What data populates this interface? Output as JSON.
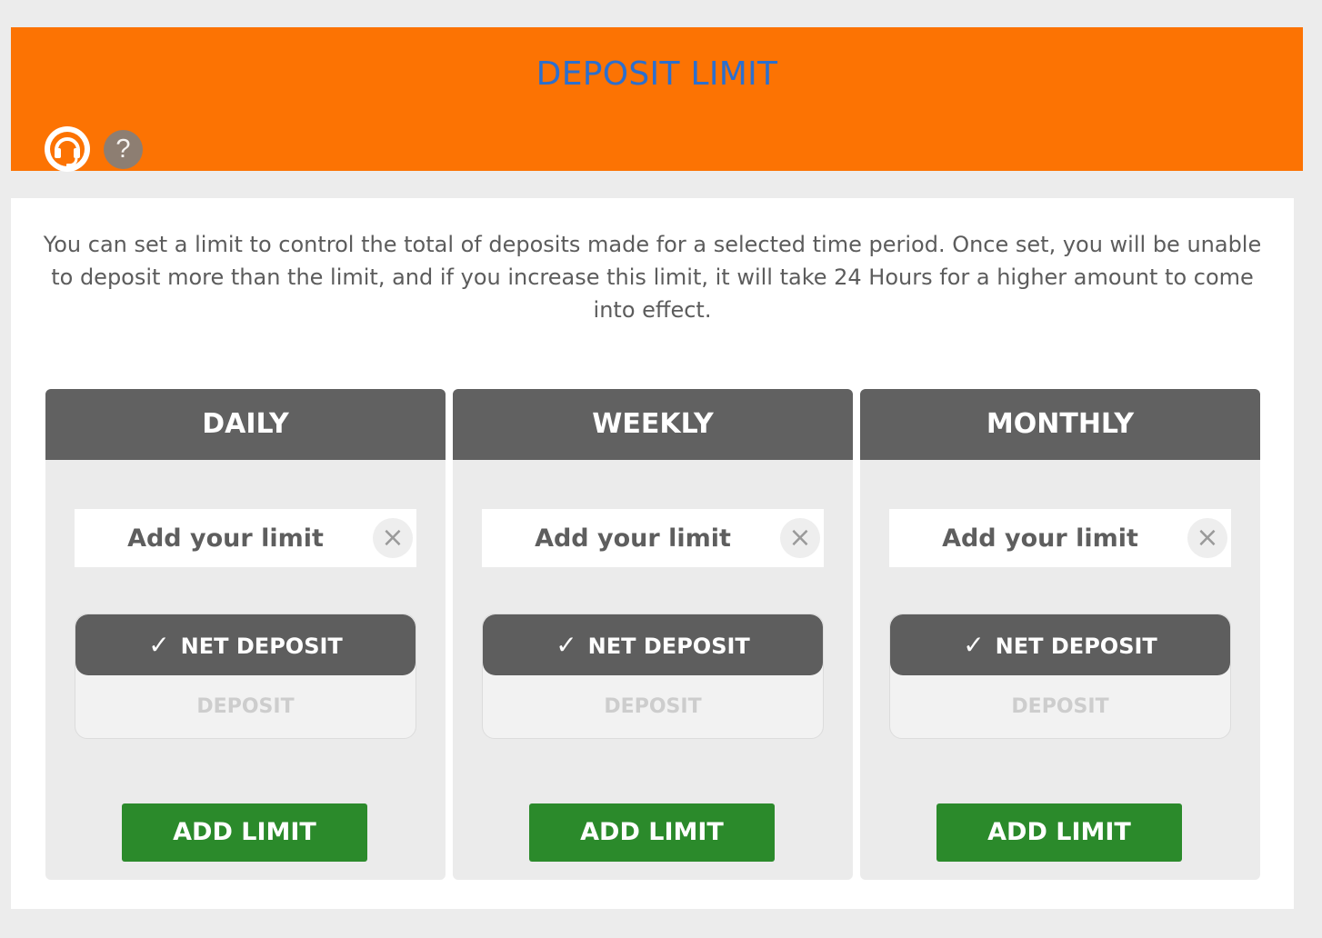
{
  "header": {
    "title": "DEPOSIT LIMIT",
    "icons": {
      "support": "headset-icon",
      "help": "?"
    }
  },
  "intro": {
    "text": "You can set a limit to control the total of deposits made for a selected time period. Once set, you will be unable to deposit more than the limit, and if you increase this limit, it will take 24 Hours for a higher amount to come into effect."
  },
  "cards": [
    {
      "title": "DAILY",
      "input_placeholder": "Add your limit",
      "clear_label": "×",
      "options": [
        {
          "label": "NET DEPOSIT",
          "selected": true
        },
        {
          "label": "DEPOSIT",
          "selected": false
        }
      ],
      "button_label": "ADD LIMIT"
    },
    {
      "title": "WEEKLY",
      "input_placeholder": "Add your limit",
      "clear_label": "×",
      "options": [
        {
          "label": "NET DEPOSIT",
          "selected": true
        },
        {
          "label": "DEPOSIT",
          "selected": false
        }
      ],
      "button_label": "ADD LIMIT"
    },
    {
      "title": "MONTHLY",
      "input_placeholder": "Add your limit",
      "clear_label": "×",
      "options": [
        {
          "label": "NET DEPOSIT",
          "selected": true
        },
        {
          "label": "DEPOSIT",
          "selected": false
        }
      ],
      "button_label": "ADD LIMIT"
    }
  ],
  "check_mark": "✓",
  "colors": {
    "header_bg": "#fc7303",
    "title": "#2b6fcf",
    "card_header": "#616161",
    "add_button": "#2b8a2b"
  }
}
